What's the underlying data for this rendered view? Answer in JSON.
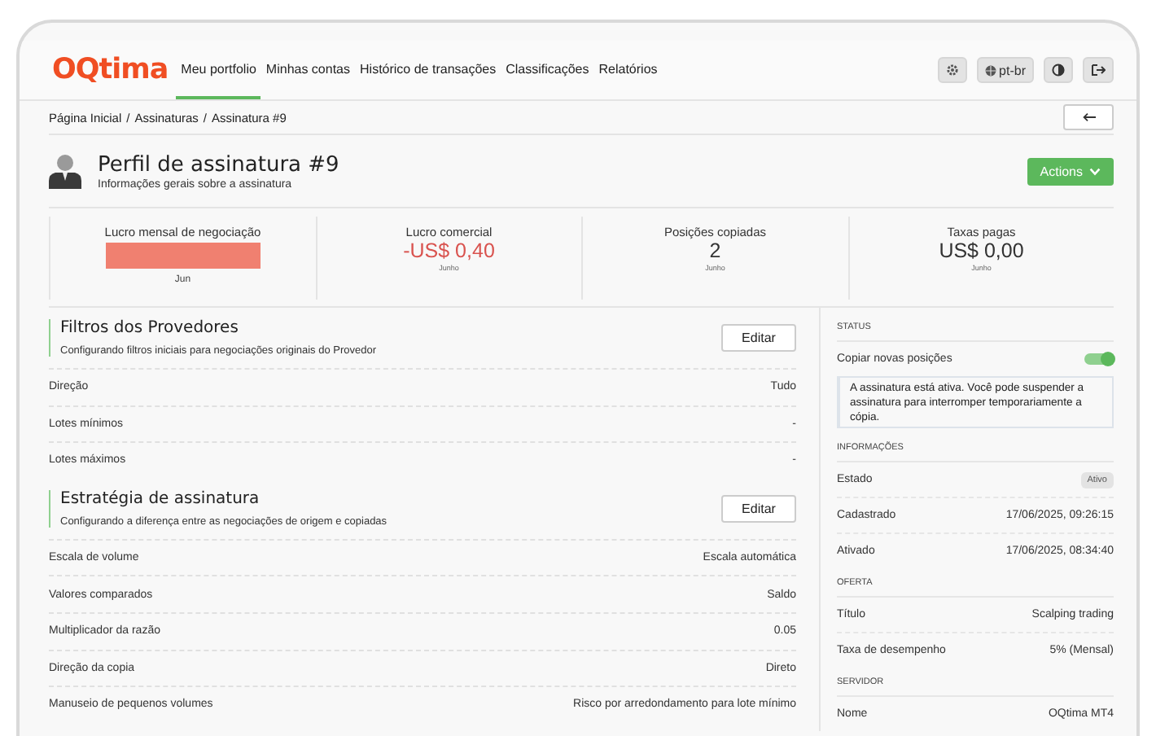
{
  "nav": {
    "logo": "OQtima",
    "items": [
      {
        "label": "Meu portfolio",
        "selected": true
      },
      {
        "label": "Minhas contas",
        "selected": false
      },
      {
        "label": "Histórico de transações",
        "selected": false
      },
      {
        "label": "Classificações",
        "selected": false
      },
      {
        "label": "Relatórios",
        "selected": false
      }
    ],
    "tools": [
      {
        "kind": "settings"
      },
      {
        "kind": "language",
        "label": "pt-br"
      },
      {
        "kind": "theme"
      },
      {
        "kind": "logout"
      }
    ]
  },
  "breadcrumb": {
    "separator": "/",
    "items": [
      "Página Inicial",
      "Assinaturas",
      "Assinatura #9"
    ]
  },
  "header": {
    "title": "Perfil de assinatura #9",
    "subtitle": "Informações gerais sobre a assinatura",
    "actions": "Actions"
  },
  "stats": [
    {
      "kind": "chart",
      "label": "Lucro mensal de negociação",
      "color": "#f08070",
      "month": "Jun"
    },
    {
      "kind": "value",
      "label": "Lucro comercial",
      "value": "-US$ 0,40",
      "negative": true,
      "note": "Junho"
    },
    {
      "kind": "value",
      "label": "Posições copiadas",
      "value": "2",
      "negative": false,
      "note": "Junho"
    },
    {
      "kind": "value",
      "label": "Taxas pagas",
      "value": "US$ 0,00",
      "negative": false,
      "note": "Junho"
    }
  ],
  "sections": [
    {
      "title": "Filtros dos Provedores",
      "subtitle": "Configurando filtros iniciais para negociações originais do Provedor",
      "button": "Editar",
      "rows": [
        {
          "label": "Direção",
          "value": "Tudo"
        },
        {
          "label": "Lotes mínimos",
          "value": "-"
        },
        {
          "label": "Lotes máximos",
          "value": "-"
        }
      ]
    },
    {
      "title": "Estratégia de assinatura",
      "subtitle": "Configurando a diferença entre as negociações de origem e copiadas",
      "button": "Editar",
      "rows": [
        {
          "label": "Escala de volume",
          "value": "Escala automática"
        },
        {
          "label": "Valores comparados",
          "value": "Saldo"
        },
        {
          "label": "Multiplicador da razão",
          "value": "0.05"
        },
        {
          "label": "Direção da copia",
          "value": "Direto"
        },
        {
          "label": "Manuseio de pequenos volumes",
          "value": "Risco por arredondamento para lote mínimo"
        }
      ]
    }
  ],
  "sidebar": [
    {
      "heading": "STATUS",
      "rows": [
        {
          "kind": "toggle",
          "label": "Copiar novas posições",
          "on": true
        },
        {
          "kind": "note",
          "text": "A assinatura está ativa. Você pode suspender a assinatura para interromper temporariamente a cópia."
        }
      ]
    },
    {
      "heading": "INFORMAÇÕES",
      "rows": [
        {
          "kind": "badge",
          "label": "Estado",
          "value": "Ativo"
        },
        {
          "kind": "text",
          "label": "Cadastrado",
          "value": "17/06/2025, 09:26:15"
        },
        {
          "kind": "text",
          "label": "Ativado",
          "value": "17/06/2025, 08:34:40"
        }
      ]
    },
    {
      "heading": "OFERTA",
      "rows": [
        {
          "kind": "text",
          "label": "Título",
          "value": "Scalping trading"
        },
        {
          "kind": "text",
          "label": "Taxa de desempenho",
          "value": "5% (Mensal)"
        }
      ]
    },
    {
      "heading": "SERVIDOR",
      "rows": [
        {
          "kind": "text",
          "label": "Nome",
          "value": "OQtima MT4"
        }
      ]
    }
  ]
}
